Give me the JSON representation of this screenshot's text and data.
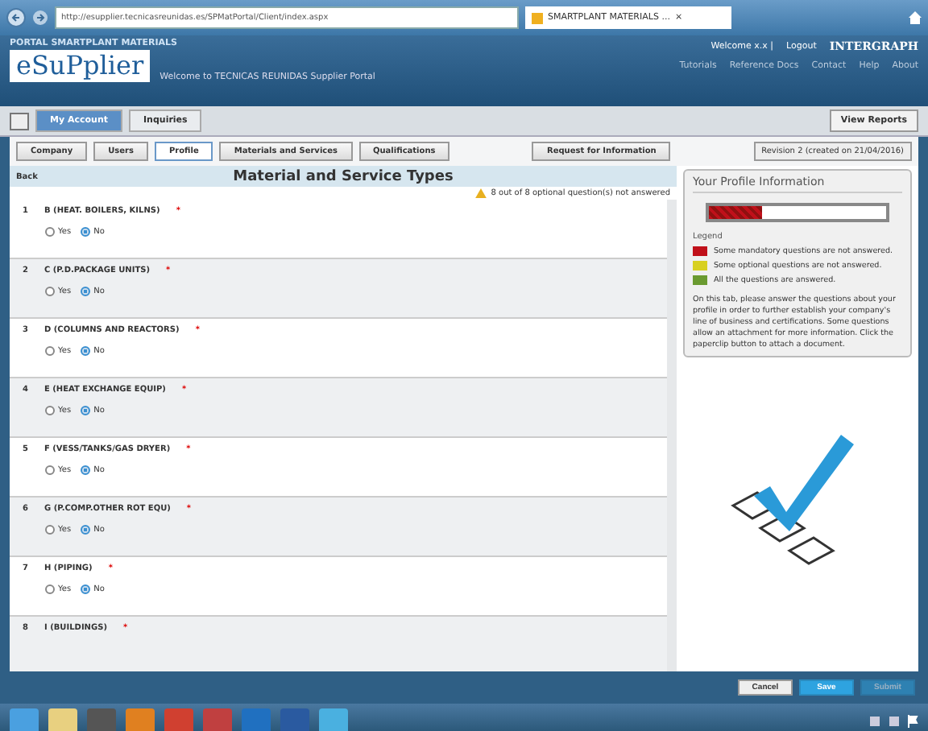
{
  "browser": {
    "address": "http://esupplier.tecnicasreunidas.es/SPMatPortal/Client/index.aspx",
    "tab_title": "SMARTPLANT MATERIALS ...",
    "tab_close": "×"
  },
  "header": {
    "portal_label": "PORTAL SMARTPLANT MATERIALS",
    "logo": "eSuPplier",
    "welcome": "Welcome to TECNICAS REUNIDAS Supplier Portal",
    "user": "Welcome x.x |",
    "logout": "Logout",
    "brand": "INTERGRAPH",
    "links": [
      "Tutorials",
      "Reference Docs",
      "Contact",
      "Help",
      "About"
    ]
  },
  "nav_tabs": [
    {
      "label": "My Account",
      "selected": true
    },
    {
      "label": "Inquiries",
      "selected": false
    }
  ],
  "view_reports": "View Reports",
  "sub_tabs": [
    {
      "label": "Company",
      "selected": false
    },
    {
      "label": "Users",
      "selected": false
    },
    {
      "label": "Profile",
      "selected": true
    },
    {
      "label": "Materials and Services",
      "selected": false
    },
    {
      "label": "Qualifications",
      "selected": false
    }
  ],
  "request_button": "Request for Information",
  "revision": "Revision 2 (created on 21/04/2016)",
  "back": "Back",
  "title": "Material and Service Types",
  "notice": "8 out of 8 optional question(s) not answered",
  "questions": [
    {
      "number": "1",
      "label": "B (HEAT. BOILERS, KILNS)",
      "required_mark": "*",
      "options": [
        {
          "label": "Yes",
          "selected": false
        },
        {
          "label": "No",
          "selected": true
        }
      ]
    },
    {
      "number": "2",
      "label": "C (P.D.PACKAGE UNITS)",
      "required_mark": "*",
      "options": [
        {
          "label": "Yes",
          "selected": false
        },
        {
          "label": "No",
          "selected": true
        }
      ]
    },
    {
      "number": "3",
      "label": "D (COLUMNS AND REACTORS)",
      "required_mark": "*",
      "options": [
        {
          "label": "Yes",
          "selected": false
        },
        {
          "label": "No",
          "selected": true
        }
      ]
    },
    {
      "number": "4",
      "label": "E (HEAT EXCHANGE EQUIP)",
      "required_mark": "*",
      "options": [
        {
          "label": "Yes",
          "selected": false
        },
        {
          "label": "No",
          "selected": true
        }
      ]
    },
    {
      "number": "5",
      "label": "F (VESS/TANKS/GAS DRYER)",
      "required_mark": "*",
      "options": [
        {
          "label": "Yes",
          "selected": false
        },
        {
          "label": "No",
          "selected": true
        }
      ]
    },
    {
      "number": "6",
      "label": "G (P.COMP.OTHER ROT EQU)",
      "required_mark": "*",
      "options": [
        {
          "label": "Yes",
          "selected": false
        },
        {
          "label": "No",
          "selected": true
        }
      ]
    },
    {
      "number": "7",
      "label": "H (PIPING)",
      "required_mark": "*",
      "options": [
        {
          "label": "Yes",
          "selected": false
        },
        {
          "label": "No",
          "selected": true
        }
      ]
    },
    {
      "number": "8",
      "label": "I (BUILDINGS)",
      "required_mark": "*"
    }
  ],
  "profile": {
    "title": "Your Profile Information",
    "level": 0.3,
    "legend_title": "Legend",
    "legend": [
      {
        "color": "#c0101a",
        "text": "Some mandatory questions are not answered."
      },
      {
        "color": "#d8d020",
        "text": "Some optional questions are not answered."
      },
      {
        "color": "#6a9a30",
        "text": "All the questions are answered."
      }
    ],
    "help": "On this tab, please answer the questions about your profile in order to further establish your company's line of business and certifications. Some questions allow an attachment for more information. Click the paperclip button to attach a document."
  },
  "buttons": [
    {
      "label": "Cancel",
      "kind": "default",
      "disabled": false
    },
    {
      "label": "Save",
      "kind": "primary",
      "disabled": false
    },
    {
      "label": "Submit",
      "kind": "primary",
      "disabled": true
    }
  ]
}
